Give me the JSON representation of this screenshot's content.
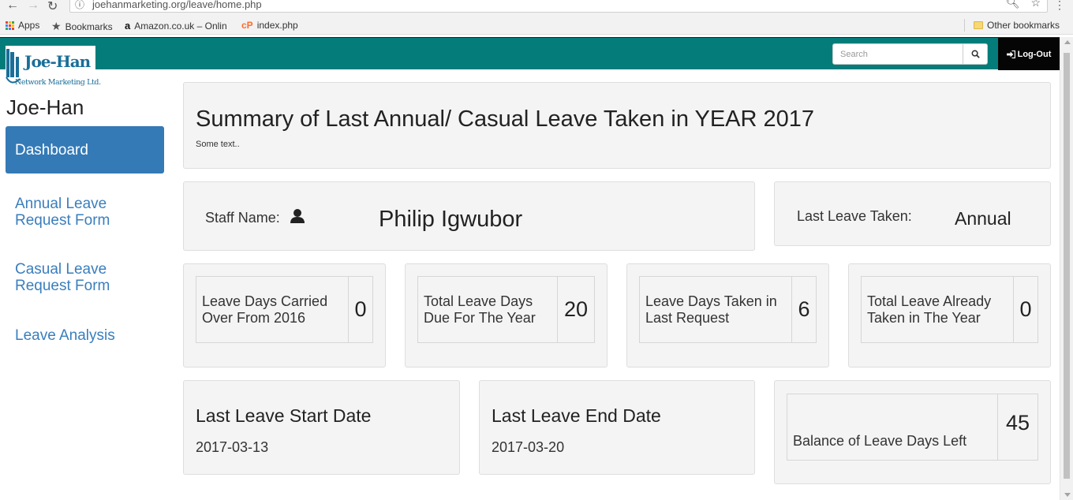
{
  "browser": {
    "url": "joehanmarketing.org/leave/home.php",
    "bookmarks": [
      {
        "label": "Apps",
        "icon": "apps-grid-icon"
      },
      {
        "label": "Bookmarks",
        "icon": "star-icon"
      },
      {
        "label": "Amazon.co.uk – Onlin",
        "icon": "amazon-icon"
      },
      {
        "label": "index.php",
        "icon": "cpanel-icon"
      }
    ],
    "other_bookmarks": "Other bookmarks"
  },
  "navbar": {
    "color": "#037c7a",
    "search_placeholder": "Search",
    "logout_label": "Log-Out"
  },
  "sidebar": {
    "logo_name": "Joe-Han",
    "logo_sub": "Network Marketing Ltd.",
    "brand_name": "Joe-Han",
    "items": [
      {
        "label": "Dashboard",
        "active": true
      },
      {
        "label": "Annual Leave Request Form"
      },
      {
        "label": "Casual Leave Request Form"
      },
      {
        "label": "Leave Analysis"
      }
    ]
  },
  "summary": {
    "title": "Summary of Last Annual/ Casual Leave Taken in YEAR 2017",
    "subtitle": "Some text.."
  },
  "staff": {
    "label": "Staff Name:",
    "name": "Philip Igwubor"
  },
  "last_leave": {
    "label": "Last Leave Taken:",
    "value": "Annual"
  },
  "stats": [
    {
      "label": "Leave Days Carried Over From 2016",
      "value": "0"
    },
    {
      "label": "Total Leave Days Due For The Year",
      "value": "20"
    },
    {
      "label": "Leave Days Taken in Last Request",
      "value": "6"
    },
    {
      "label": "Total Leave Already Taken in The Year",
      "value": "0"
    }
  ],
  "dates": {
    "start_title": "Last Leave Start Date",
    "start_value": "2017-03-13",
    "end_title": "Last Leave End Date",
    "end_value": "2017-03-20"
  },
  "balance": {
    "label": "Balance of Leave Days Left",
    "value": "45"
  }
}
